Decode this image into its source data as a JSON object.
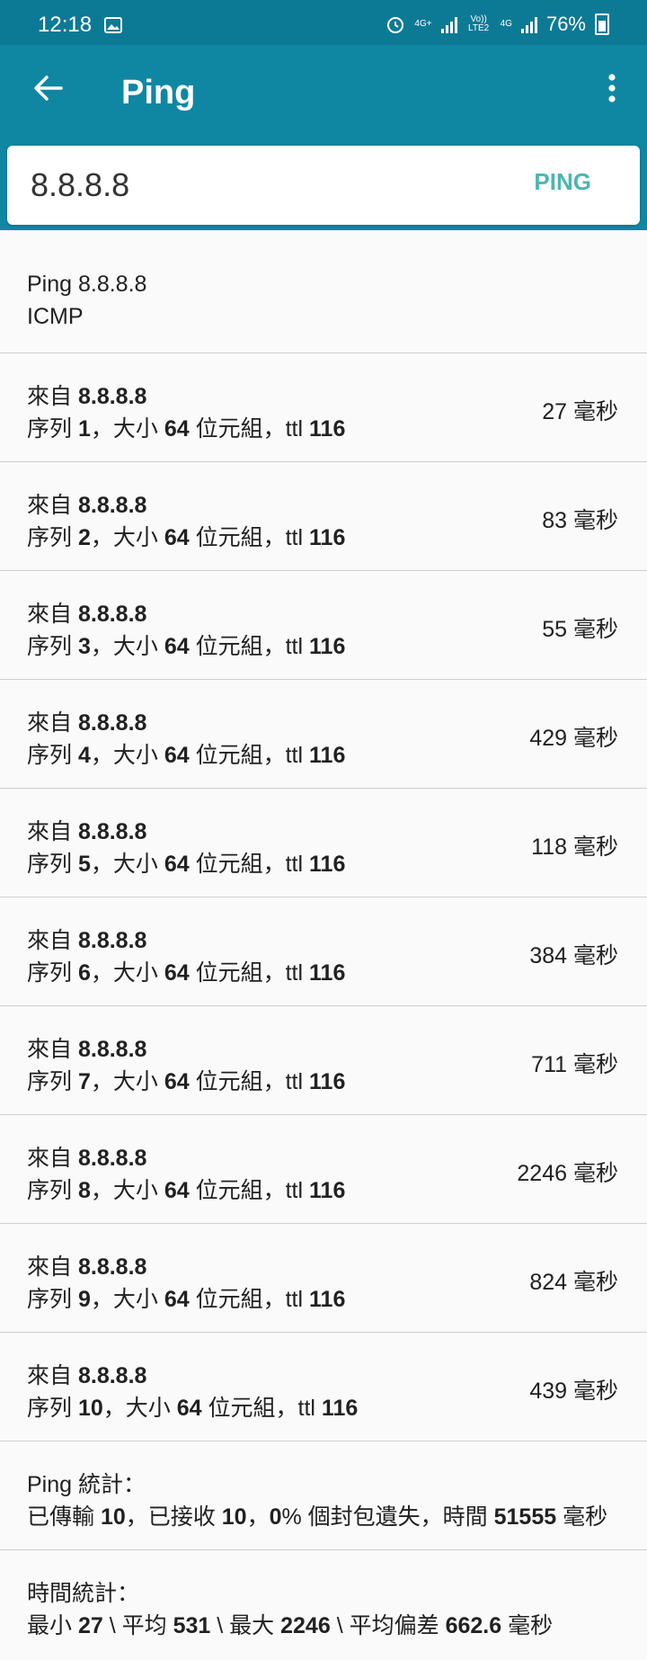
{
  "status_bar": {
    "time": "12:18",
    "network_1": "4G+",
    "volte": "Vo)) LTE2",
    "network_2": "4G",
    "battery": "76%"
  },
  "app_bar": {
    "title": "Ping"
  },
  "search": {
    "host_value": "8.8.8.8",
    "ping_button": "PING"
  },
  "header": {
    "line1": "Ping 8.8.8.8",
    "protocol": "ICMP"
  },
  "labels": {
    "from": "來自",
    "seq": "序列",
    "size_prefix": "，大小",
    "bytes_suffix": "位元組，ttl",
    "ms": "毫秒"
  },
  "replies": [
    {
      "from": "8.8.8.8",
      "seq": "1",
      "size": "64",
      "ttl": "116",
      "time": "27"
    },
    {
      "from": "8.8.8.8",
      "seq": "2",
      "size": "64",
      "ttl": "116",
      "time": "83"
    },
    {
      "from": "8.8.8.8",
      "seq": "3",
      "size": "64",
      "ttl": "116",
      "time": "55"
    },
    {
      "from": "8.8.8.8",
      "seq": "4",
      "size": "64",
      "ttl": "116",
      "time": "429"
    },
    {
      "from": "8.8.8.8",
      "seq": "5",
      "size": "64",
      "ttl": "116",
      "time": "118"
    },
    {
      "from": "8.8.8.8",
      "seq": "6",
      "size": "64",
      "ttl": "116",
      "time": "384"
    },
    {
      "from": "8.8.8.8",
      "seq": "7",
      "size": "64",
      "ttl": "116",
      "time": "711"
    },
    {
      "from": "8.8.8.8",
      "seq": "8",
      "size": "64",
      "ttl": "116",
      "time": "2246"
    },
    {
      "from": "8.8.8.8",
      "seq": "9",
      "size": "64",
      "ttl": "116",
      "time": "824"
    },
    {
      "from": "8.8.8.8",
      "seq": "10",
      "size": "64",
      "ttl": "116",
      "time": "439"
    }
  ],
  "ping_stats": {
    "title": "Ping 統計：",
    "sent_label": "已傳輸",
    "sent": "10",
    "received_label": "，已接收",
    "received": "10",
    "loss_sep": "，",
    "loss": "0",
    "loss_label": "% 個封包遺失，時間",
    "time": "51555",
    "ms": "毫秒"
  },
  "time_stats": {
    "title": "時間統計：",
    "min_label": "最小",
    "min": "27",
    "avg_label": "\\ 平均",
    "avg": "531",
    "max_label": "\\ 最大",
    "max": "2246",
    "mdev_label": "\\ 平均偏差",
    "mdev": "662.6",
    "ms": "毫秒"
  }
}
